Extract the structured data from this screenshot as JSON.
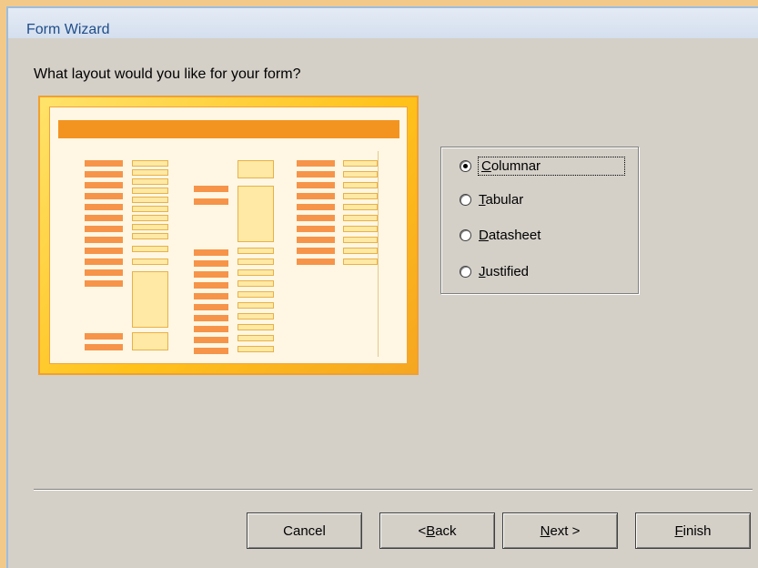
{
  "window": {
    "title": "Form Wizard"
  },
  "prompt": "What layout would you like for your form?",
  "layout_options": [
    {
      "prefix": "",
      "mnemonic": "C",
      "rest": "olumnar",
      "selected": true
    },
    {
      "prefix": "",
      "mnemonic": "T",
      "rest": "abular",
      "selected": false
    },
    {
      "prefix": "",
      "mnemonic": "D",
      "rest": "atasheet",
      "selected": false
    },
    {
      "prefix": "",
      "mnemonic": "J",
      "rest": "ustified",
      "selected": false
    }
  ],
  "buttons": {
    "cancel": {
      "label": "Cancel"
    },
    "back": {
      "prefix": "< ",
      "mnemonic": "B",
      "rest": "ack"
    },
    "next": {
      "prefix": "",
      "mnemonic": "N",
      "rest": "ext >"
    },
    "finish": {
      "prefix": "",
      "mnemonic": "F",
      "rest": "inish"
    }
  },
  "colors": {
    "accent_header": "#f39420",
    "preview_frame": "#ffc21a",
    "title_text": "#1f4d8a"
  }
}
